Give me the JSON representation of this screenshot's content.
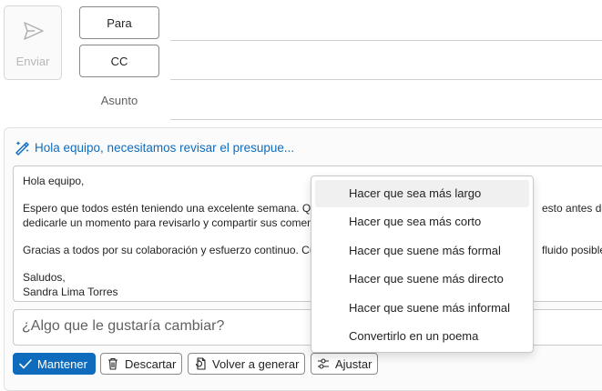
{
  "header": {
    "send_label": "Enviar",
    "to_label": "Para",
    "cc_label": "CC",
    "subject_label": "Asunto"
  },
  "copilot": {
    "prompt_title": "Hola equipo, necesitamos revisar el presupue...",
    "draft_lines": [
      "Hola equipo,",
      "Espero que todos estén teniendo una excelente semana. Quería",
      "dedicarle un momento para revisarlo y compartir sus comentar",
      "Gracias a todos por su colaboración y esfuerzo continuo. Cuent",
      "Saludos,",
      "Sandra Lima Torres"
    ],
    "draft_line_tail_1": "esto antes del v",
    "draft_line_tail_3": "fluido posible.",
    "ask_placeholder": "¿Algo que le gustaría cambiar?"
  },
  "actions": {
    "keep_label": "Mantener",
    "discard_label": "Descartar",
    "regenerate_label": "Volver a generar",
    "adjust_label": "Ajustar"
  },
  "adjust_menu": {
    "items": [
      "Hacer que sea más largo",
      "Hacer que sea más corto",
      "Hacer que suene más formal",
      "Hacer que suene más directo",
      "Hacer que suene más informal",
      "Convertirlo en un poema"
    ]
  },
  "colors": {
    "accent": "#0f6cbd",
    "border": "#8a8a8a",
    "hover": "#f0f0f0"
  },
  "icons": {
    "send": "send-icon",
    "copilot": "copilot-pen-icon",
    "keep": "checkmark-icon",
    "discard": "trash-icon",
    "regenerate": "regenerate-icon",
    "adjust": "sliders-icon"
  }
}
